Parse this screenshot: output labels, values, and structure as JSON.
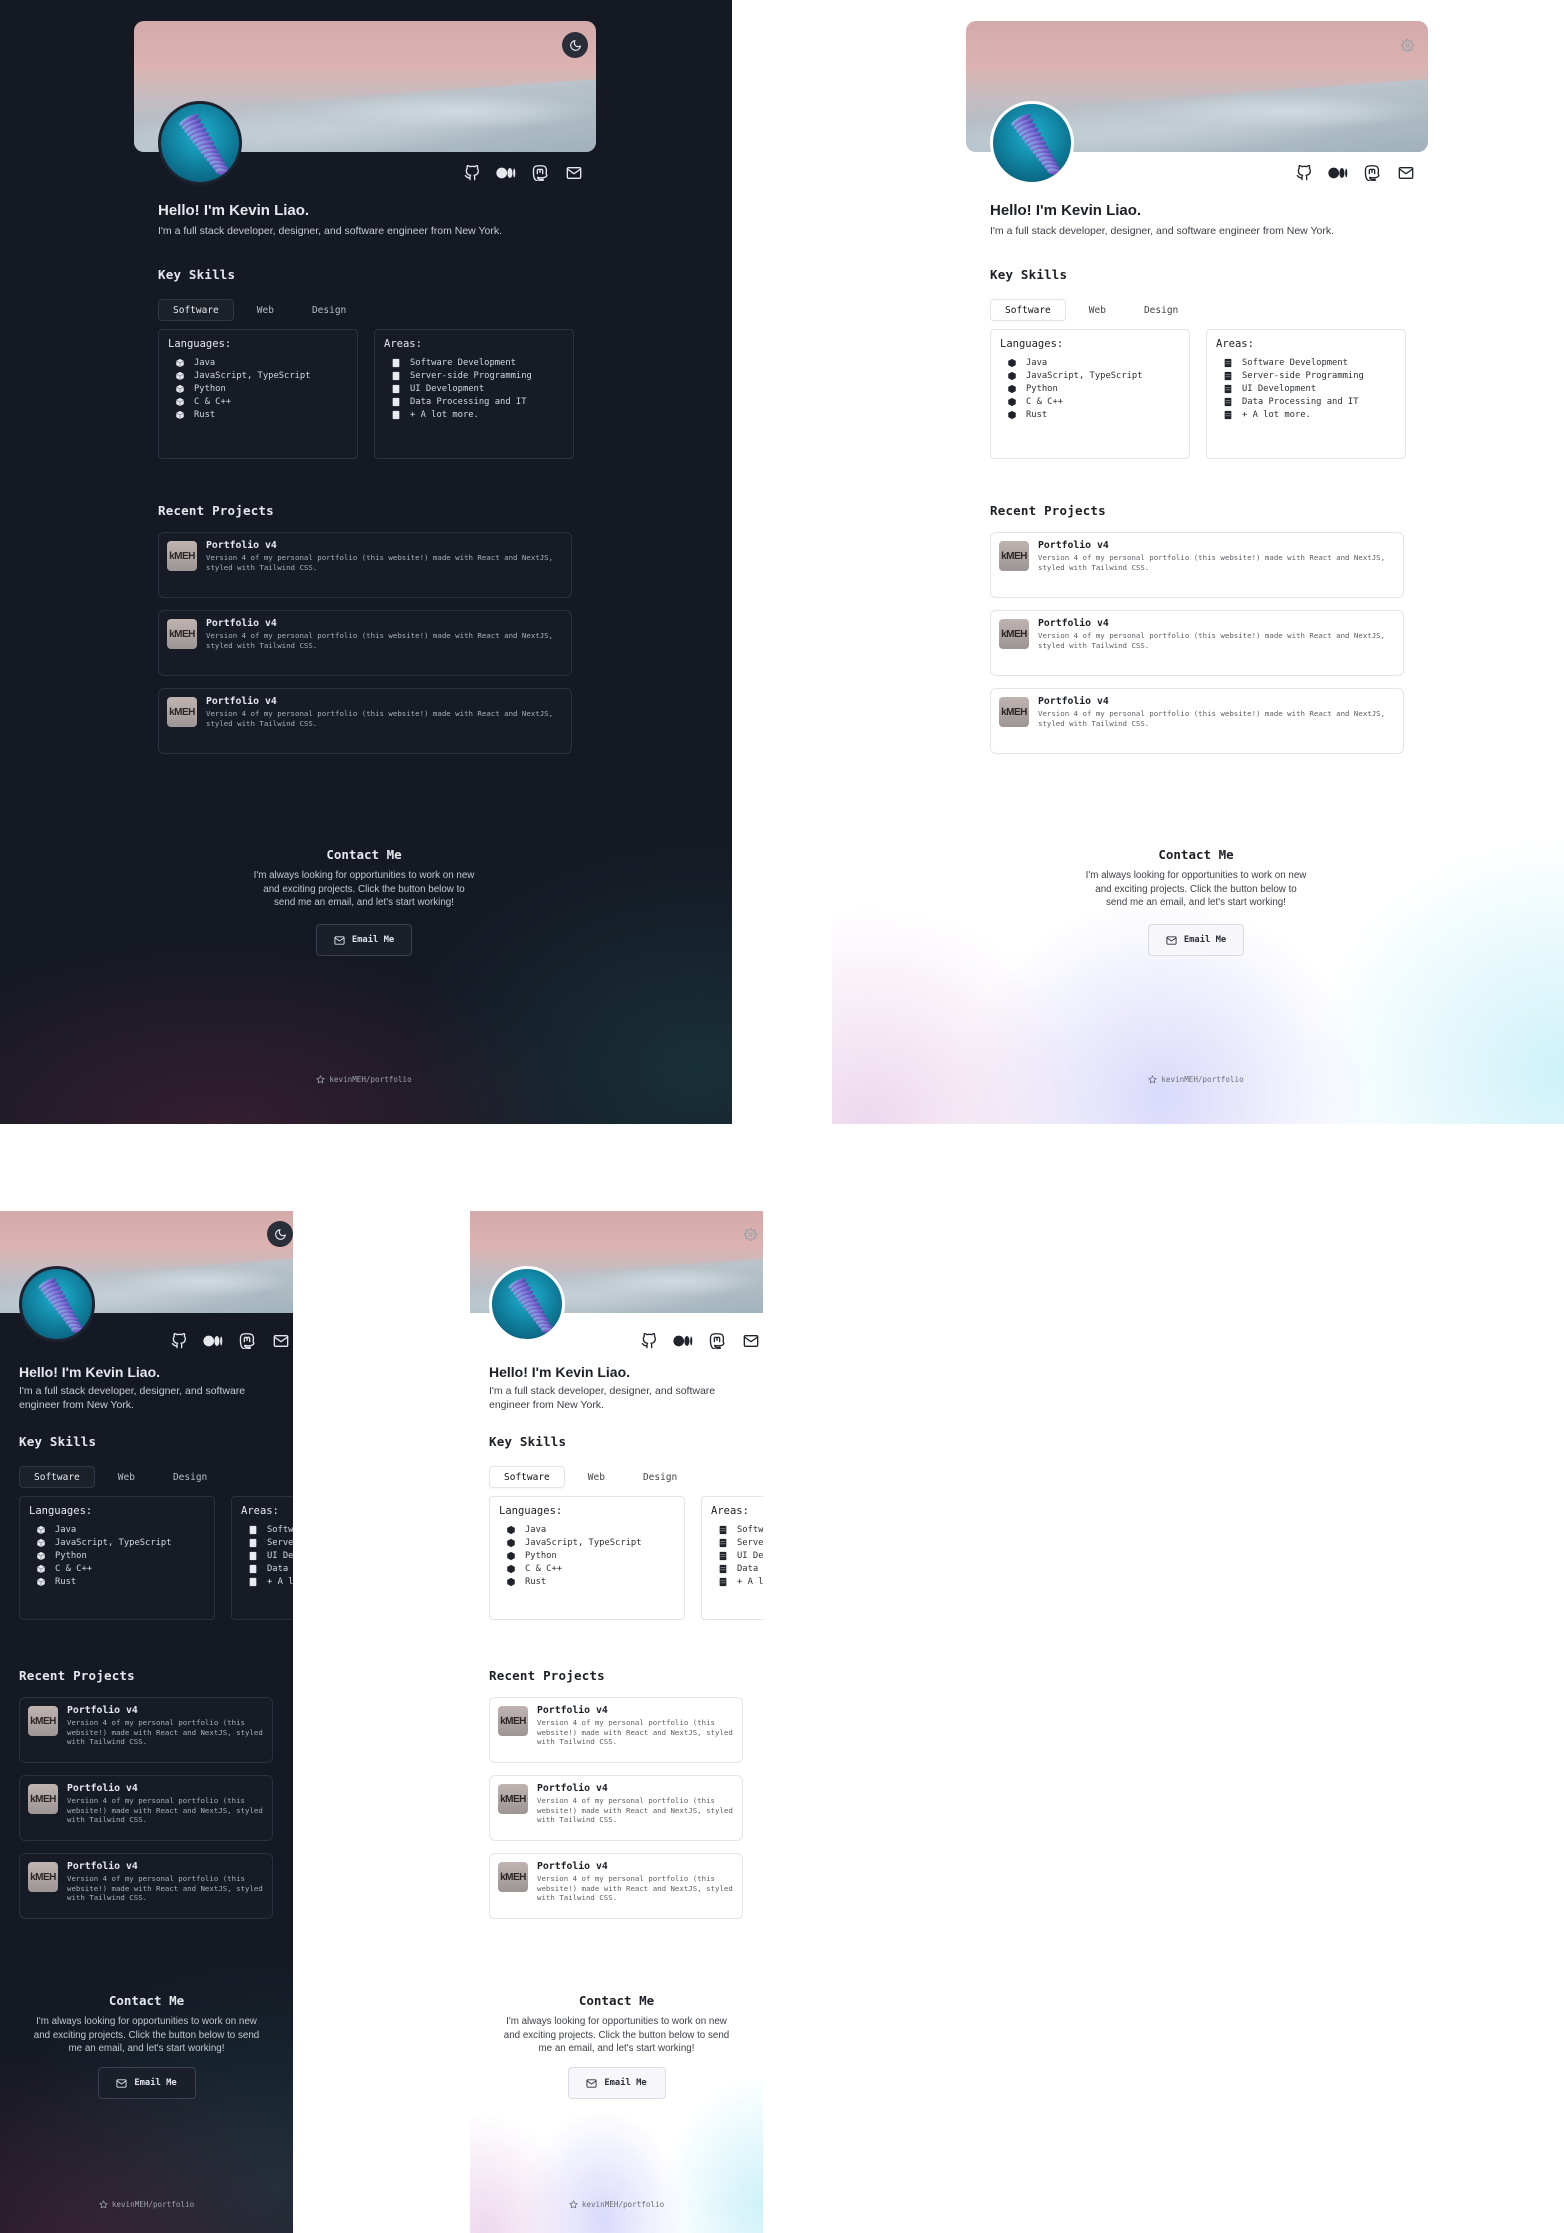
{
  "profile": {
    "greeting": "Hello! I'm Kevin Liao.",
    "tagline": "I'm a full stack developer, designer, and software engineer from New York.",
    "tagline_narrow_line1": "I'm a full stack developer, designer, and software",
    "tagline_narrow_line2": "engineer from New York."
  },
  "icons": {
    "theme_dark": "moon-icon",
    "theme_light": "gear-icon",
    "socials": [
      "github-icon",
      "medium-icon",
      "mastodon-icon",
      "email-icon"
    ]
  },
  "skills": {
    "heading": "Key Skills",
    "tabs": [
      "Software",
      "Web",
      "Design"
    ],
    "active_tab": "Software",
    "languages": {
      "title": "Languages:",
      "items": [
        "Java",
        "JavaScript, TypeScript",
        "Python",
        "C & C++",
        "Rust"
      ]
    },
    "areas": {
      "title": "Areas:",
      "items": [
        "Software Development",
        "Server-side Programming",
        "UI Development",
        "Data Processing and IT",
        "+ A lot more."
      ]
    }
  },
  "projects": {
    "heading": "Recent Projects",
    "items": [
      {
        "thumb": "kMEH",
        "title": "Portfolio v4",
        "description": "Version 4 of my personal portfolio (this website!) made with React and NextJS, styled with Tailwind CSS."
      },
      {
        "thumb": "kMEH",
        "title": "Portfolio v4",
        "description": "Version 4 of my personal portfolio (this website!) made with React and NextJS, styled with Tailwind CSS."
      },
      {
        "thumb": "kMEH",
        "title": "Portfolio v4",
        "description": "Version 4 of my personal portfolio (this website!) made with React and NextJS, styled with Tailwind CSS."
      }
    ]
  },
  "contact": {
    "heading": "Contact Me",
    "text_wide": [
      "I'm always looking for opportunities to work on new",
      "and exciting projects. Click the button below to",
      "send me an email, and let's start working!"
    ],
    "text_narrow": [
      "I'm always looking for opportunities to work on new",
      "and exciting projects. Click the button below to send",
      "me an email, and let's start working!"
    ],
    "button_label": "Email Me"
  },
  "footer": {
    "label": "kevinMEH/portfolio",
    "icon": "star-icon"
  },
  "colors": {
    "dark_background": "#151924",
    "light_background": "#ffffff",
    "avatar_accent": "#1fb1d0"
  }
}
